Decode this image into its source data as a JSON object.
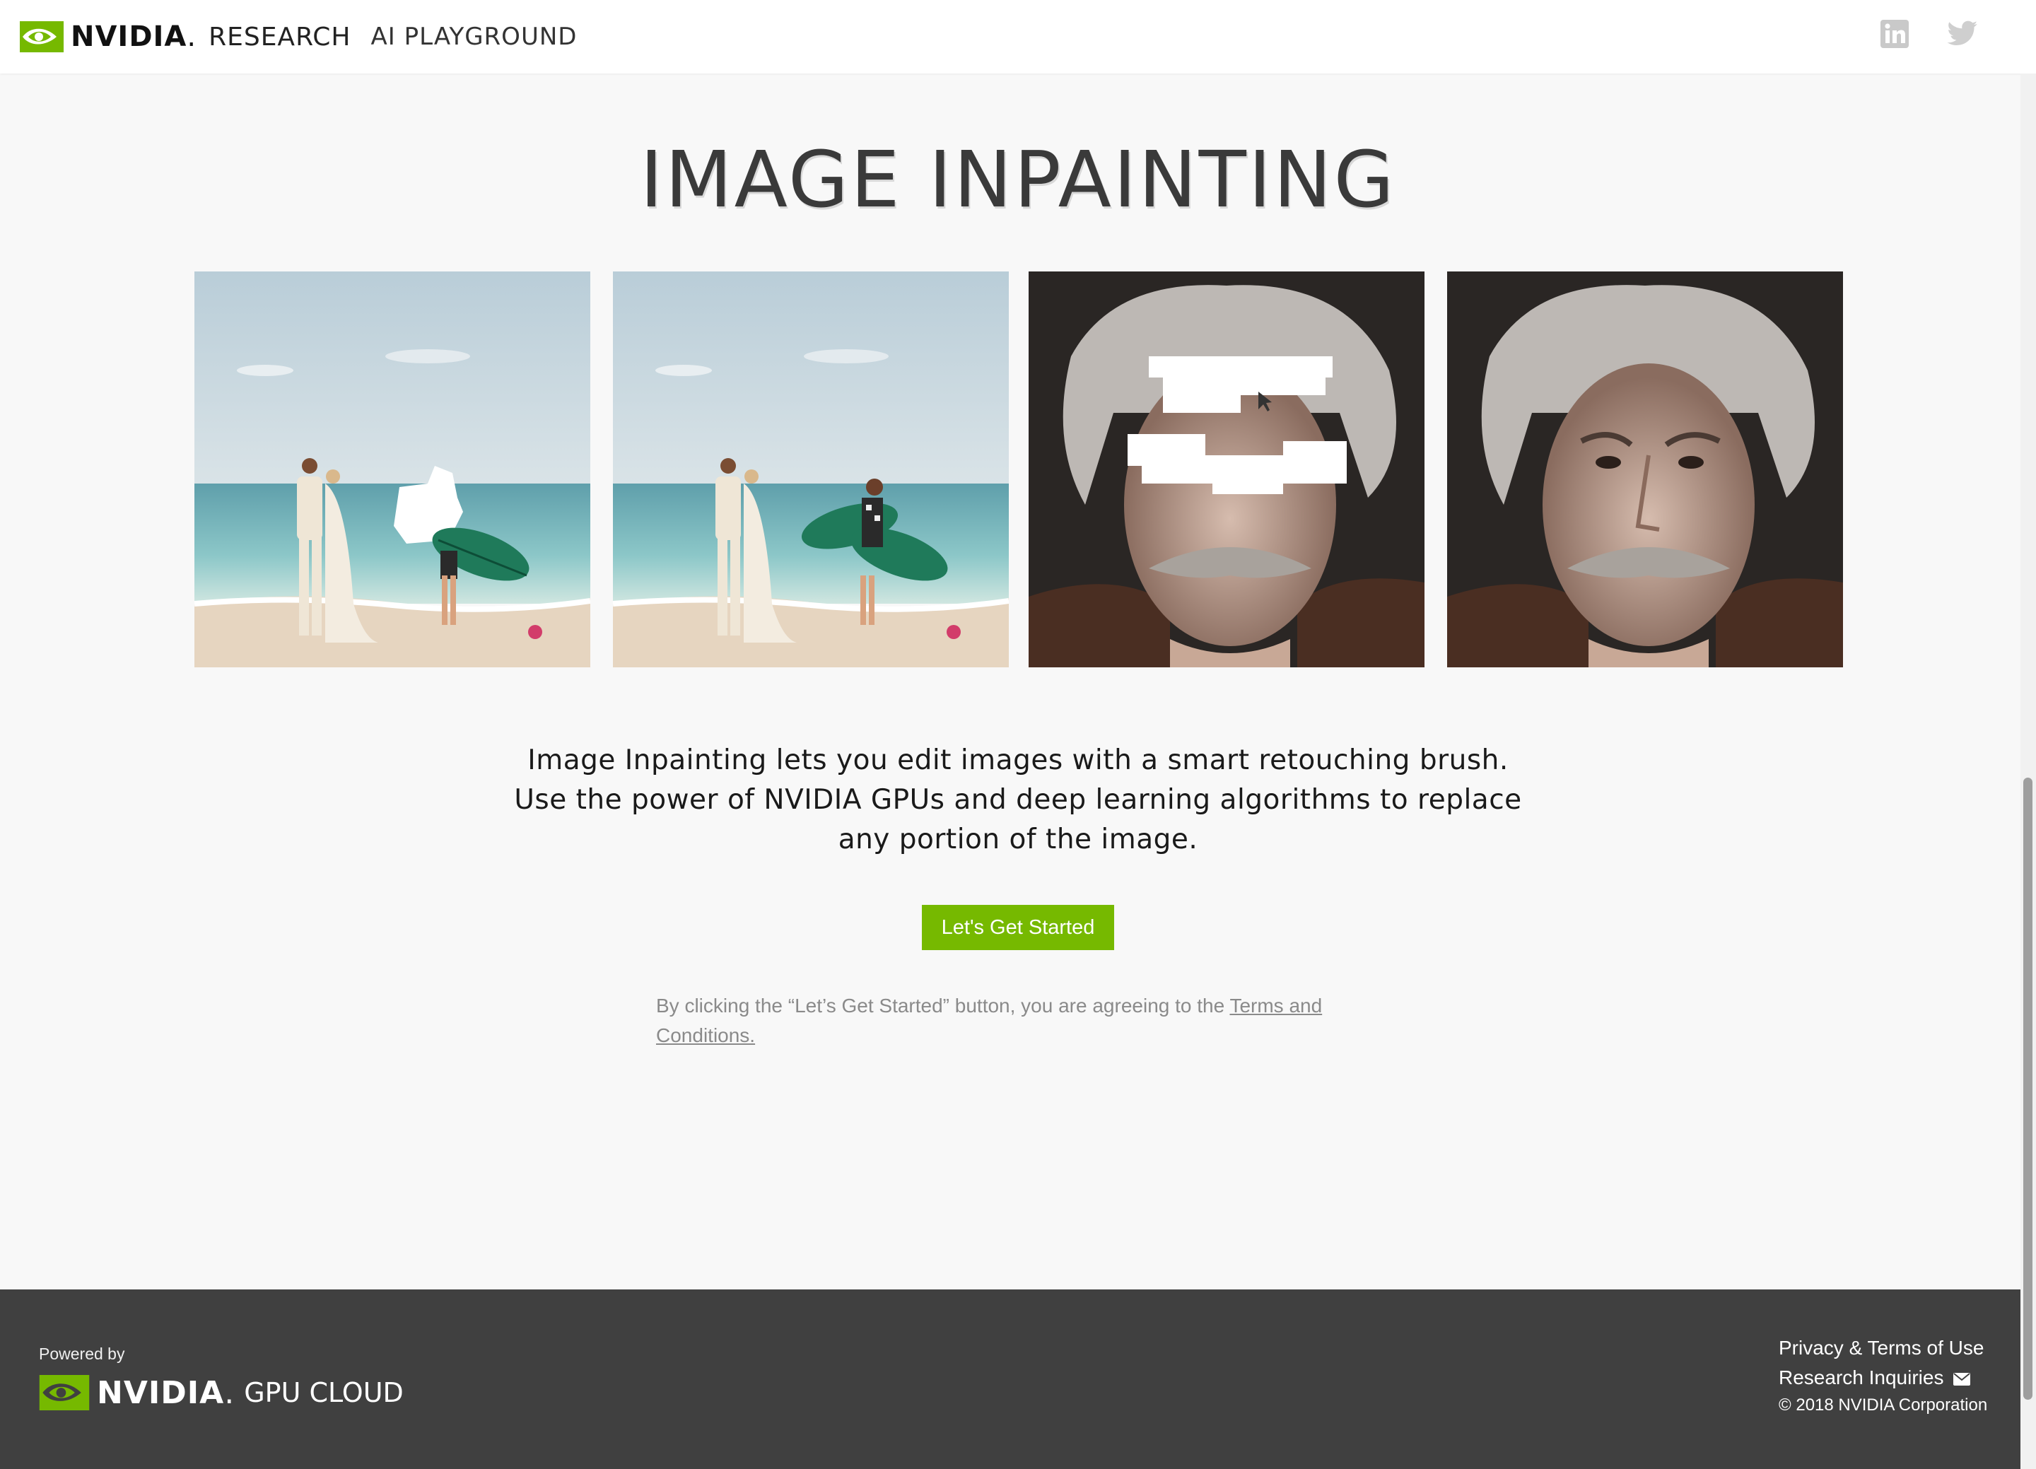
{
  "header": {
    "brand_word": "NVIDIA",
    "brand_section": "RESEARCH",
    "app_name": "AI PLAYGROUND",
    "social": [
      "linkedin-icon",
      "twitter-icon"
    ]
  },
  "main": {
    "title": "IMAGE INPAINTING",
    "description_lines": [
      "Image Inpainting lets you edit images with a smart retouching brush.",
      "Use the power of NVIDIA GPUs and deep learning algorithms to replace",
      "any portion of the image."
    ],
    "cta_label": "Let's Get Started",
    "terms_text": "By clicking the “Let’s Get Started” button, you are agreeing to the ",
    "terms_link": "Terms and Conditions."
  },
  "footer": {
    "powered_by": "Powered by",
    "brand_word": "NVIDIA",
    "brand_product": "GPU CLOUD",
    "links": [
      "Privacy & Terms of Use",
      "Research Inquiries"
    ],
    "copyright": "© 2018 NVIDIA Corporation"
  },
  "colors": {
    "accent": "#76b900",
    "footer_bg": "#404040",
    "page_bg": "#f8f8f8"
  }
}
